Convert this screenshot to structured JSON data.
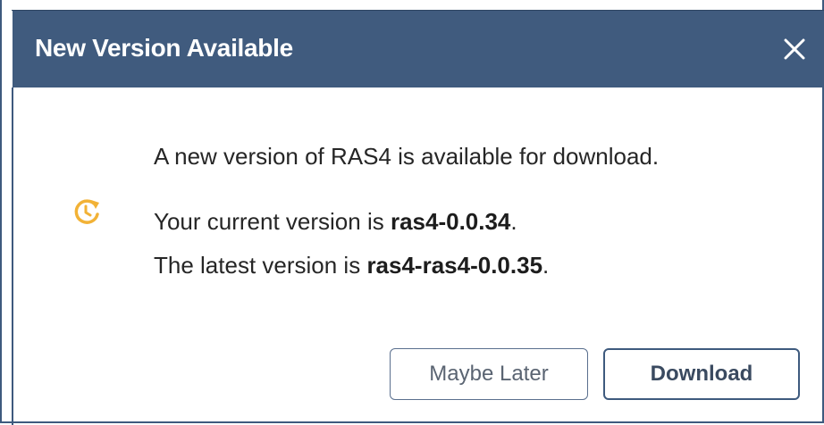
{
  "dialog": {
    "title": "New Version Available",
    "close_icon": "close-icon",
    "status_icon": "refresh-clock-icon",
    "message_line1": "A new version of RAS4 is available for download.",
    "current_prefix": "Your current version is ",
    "current_version": "ras4-0.0.34",
    "current_suffix": ".",
    "latest_prefix": "The latest version is ",
    "latest_version": "ras4-ras4-0.0.35",
    "latest_suffix": ".",
    "buttons": {
      "maybe_later": "Maybe Later",
      "download": "Download"
    }
  },
  "colors": {
    "titlebar": "#405b7e",
    "accent_icon": "#f2b236",
    "text": "#262626"
  }
}
